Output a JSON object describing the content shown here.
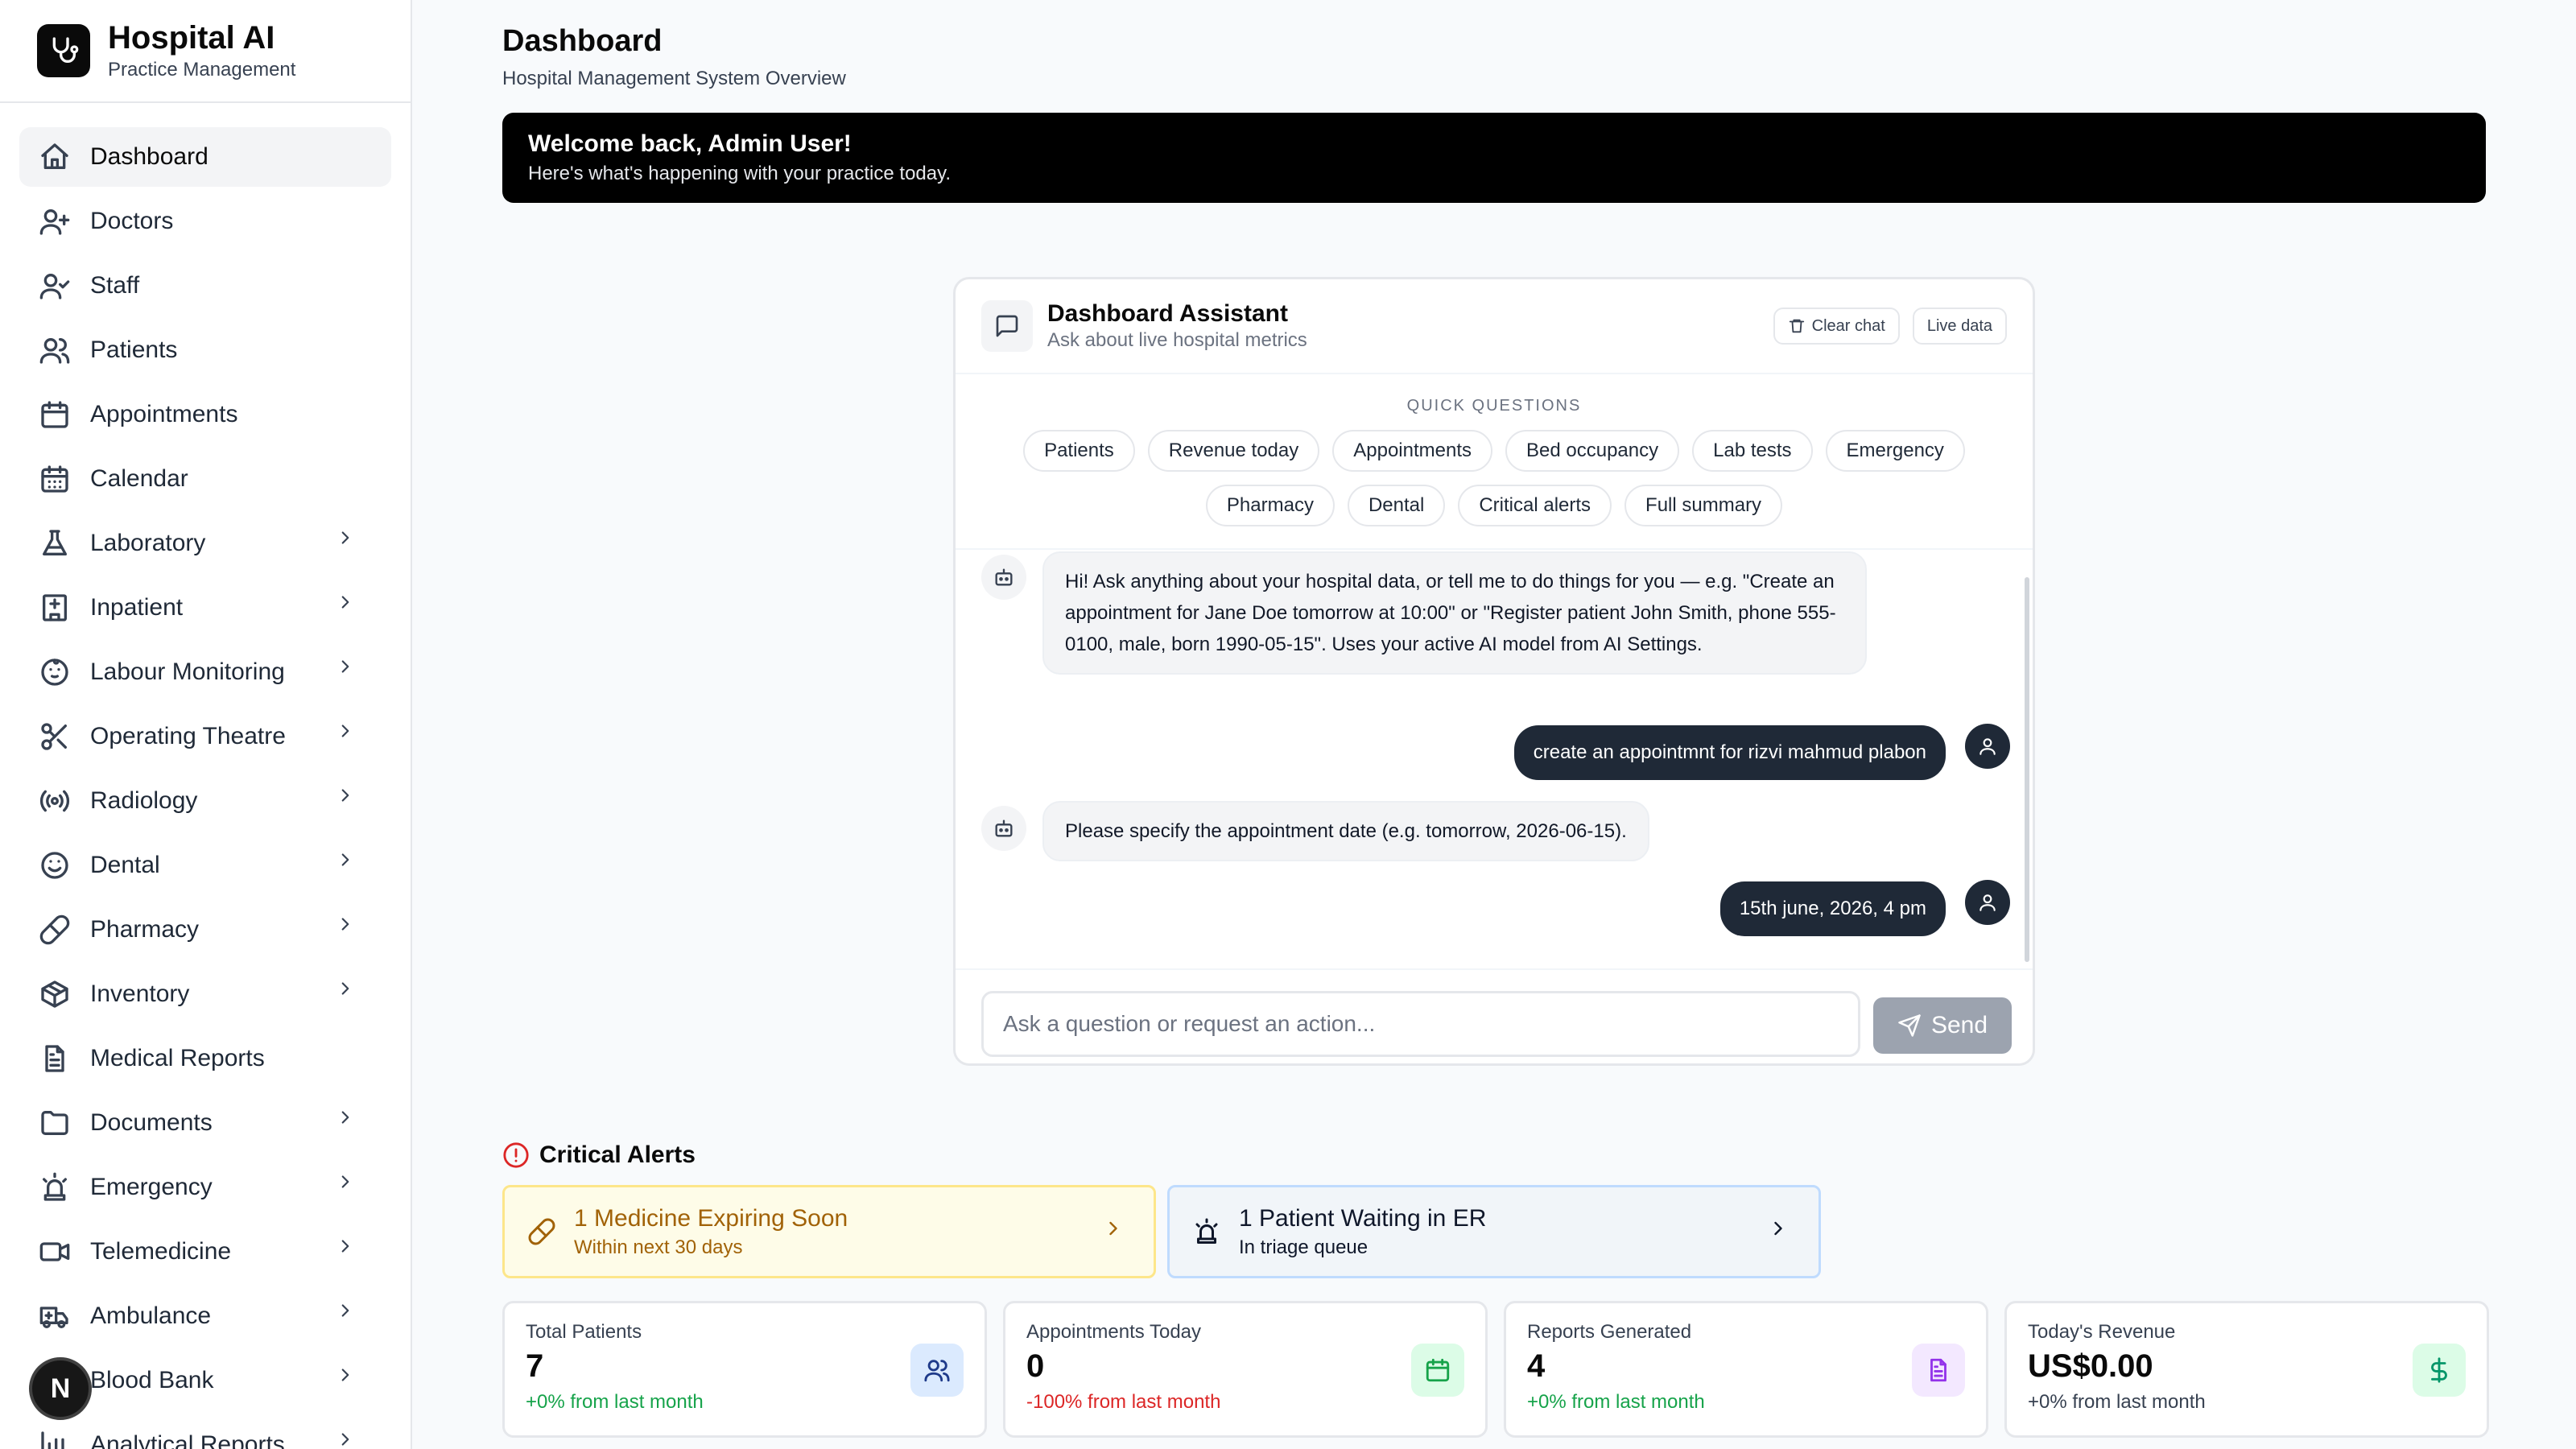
{
  "brand": {
    "name": "Hospital AI",
    "subtitle": "Practice Management"
  },
  "sidebar": {
    "items": [
      {
        "label": "Dashboard",
        "icon": "home-icon",
        "active": true,
        "has_submenu": false
      },
      {
        "label": "Doctors",
        "icon": "user-plus-icon",
        "has_submenu": false
      },
      {
        "label": "Staff",
        "icon": "user-check-icon",
        "has_submenu": false
      },
      {
        "label": "Patients",
        "icon": "users-icon",
        "has_submenu": false
      },
      {
        "label": "Appointments",
        "icon": "calendar-icon",
        "has_submenu": false
      },
      {
        "label": "Calendar",
        "icon": "calendar-days-icon",
        "has_submenu": false
      },
      {
        "label": "Laboratory",
        "icon": "flask-icon",
        "has_submenu": true
      },
      {
        "label": "Inpatient",
        "icon": "hospital-icon",
        "has_submenu": true
      },
      {
        "label": "Labour Monitoring",
        "icon": "baby-icon",
        "has_submenu": true
      },
      {
        "label": "Operating Theatre",
        "icon": "scissors-icon",
        "has_submenu": true
      },
      {
        "label": "Radiology",
        "icon": "radio-icon",
        "has_submenu": true
      },
      {
        "label": "Dental",
        "icon": "smile-icon",
        "has_submenu": true
      },
      {
        "label": "Pharmacy",
        "icon": "pill-icon",
        "has_submenu": true
      },
      {
        "label": "Inventory",
        "icon": "package-icon",
        "has_submenu": true
      },
      {
        "label": "Medical Reports",
        "icon": "file-text-icon",
        "has_submenu": false
      },
      {
        "label": "Documents",
        "icon": "folder-icon",
        "has_submenu": true
      },
      {
        "label": "Emergency",
        "icon": "siren-icon",
        "has_submenu": true
      },
      {
        "label": "Telemedicine",
        "icon": "video-icon",
        "has_submenu": true
      },
      {
        "label": "Ambulance",
        "icon": "ambulance-icon",
        "has_submenu": true
      },
      {
        "label": "Blood Bank",
        "icon": "droplet-icon",
        "has_submenu": true
      },
      {
        "label": "Analytical Reports",
        "icon": "bar-chart-icon",
        "has_submenu": true
      }
    ],
    "floating_avatar": "N"
  },
  "header": {
    "title": "Dashboard",
    "subtitle": "Hospital Management System Overview"
  },
  "welcome": {
    "title": "Welcome back, Admin User!",
    "subtitle": "Here's what's happening with your practice today."
  },
  "assistant": {
    "title": "Dashboard Assistant",
    "subtitle": "Ask about live hospital metrics",
    "clear_label": "Clear chat",
    "live_label": "Live data",
    "quick_label": "QUICK QUESTIONS",
    "quick_questions": [
      "Patients",
      "Revenue today",
      "Appointments",
      "Bed occupancy",
      "Lab tests",
      "Emergency",
      "Pharmacy",
      "Dental",
      "Critical alerts",
      "Full summary"
    ],
    "messages": [
      {
        "role": "bot",
        "text": "Hi! Ask anything about your hospital data, or tell me to do things for you — e.g. \"Create an appointment for Jane Doe tomorrow at 10:00\" or \"Register patient John Smith, phone 555-0100, male, born 1990-05-15\". Uses your active AI model from AI Settings."
      },
      {
        "role": "user",
        "text": "create an appointmnt for rizvi mahmud plabon"
      },
      {
        "role": "bot",
        "text": "Please specify the appointment date (e.g. tomorrow, 2026-06-15)."
      },
      {
        "role": "user",
        "text": "15th june, 2026, 4 pm"
      }
    ],
    "input_placeholder": "Ask a question or request an action...",
    "input_value": "",
    "send_label": "Send"
  },
  "alerts": {
    "title": "Critical Alerts",
    "items": [
      {
        "title": "1 Medicine Expiring Soon",
        "subtitle": "Within next 30 days",
        "icon": "pill-icon",
        "color": "#a16207"
      },
      {
        "title": "1 Patient Waiting in ER",
        "subtitle": "In triage queue",
        "icon": "siren-icon",
        "color": "#0f172a"
      }
    ]
  },
  "stats": [
    {
      "label": "Total Patients",
      "value": "7",
      "change": "+0% from last month",
      "change_color": "#16a34a",
      "icon": "users-icon",
      "icon_bg": "#dbeafe",
      "icon_color": "#1e3a8a"
    },
    {
      "label": "Appointments Today",
      "value": "0",
      "change": "-100% from last month",
      "change_color": "#dc2626",
      "icon": "calendar-icon",
      "icon_bg": "#dcfce7",
      "icon_color": "#16a34a"
    },
    {
      "label": "Reports Generated",
      "value": "4",
      "change": "+0% from last month",
      "change_color": "#16a34a",
      "icon": "file-text-icon",
      "icon_bg": "#f3e8ff",
      "icon_color": "#9333ea"
    },
    {
      "label": "Today's Revenue",
      "value": "US$0.00",
      "change": "+0% from last month",
      "change_color": "#374151",
      "icon": "dollar-icon",
      "icon_bg": "#dcfce7",
      "icon_color": "#059669"
    }
  ]
}
